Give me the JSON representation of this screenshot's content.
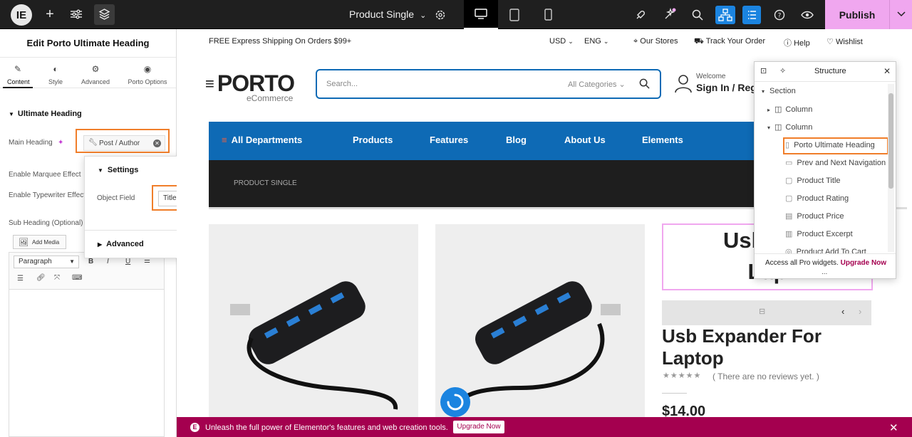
{
  "topbar": {
    "logo_glyph": "IE",
    "document_title": "Product Single",
    "publish_label": "Publish",
    "accent_color": "#f0a7ef",
    "active_icon_color": "#1b84e0"
  },
  "panel": {
    "title": "Edit Porto Ultimate Heading",
    "tabs": [
      {
        "label": "Content",
        "icon": "pencil-icon"
      },
      {
        "label": "Style",
        "icon": "contrast-icon"
      },
      {
        "label": "Advanced",
        "icon": "gear-icon"
      },
      {
        "label": "Porto Options",
        "icon": "circle-icon"
      }
    ],
    "section_title": "Ultimate Heading",
    "main_heading_label": "Main Heading",
    "dynamic_tag_value": "Post / Author",
    "marquee_label": "Enable Marquee Effect",
    "typewriter_label": "Enable Typewriter Effect",
    "sub_heading_label": "Sub Heading (Optional)",
    "add_media_label": "Add Media",
    "editor_format": "Paragraph",
    "editor_buttons": [
      "B",
      "I",
      "U"
    ]
  },
  "popup": {
    "settings_title": "Settings",
    "object_field_label": "Object Field",
    "object_field_value": "Title",
    "advanced_title": "Advanced"
  },
  "site": {
    "promo": "FREE Express Shipping On Orders $99+",
    "currency": "USD",
    "language": "ENG",
    "our_stores": "Our Stores",
    "track_order": "Track Your Order",
    "help": "Help",
    "wishlist": "Wishlist",
    "logo_main": "PORTO",
    "logo_sub": "eCommerce",
    "search_placeholder": "Search...",
    "search_category": "All Categories",
    "welcome": "Welcome",
    "sign_in": "Sign In / Reg",
    "all_departments": "All Departments",
    "nav": [
      "Products",
      "Features",
      "Blog",
      "About Us",
      "Elements"
    ],
    "breadcrumb": "PRODUCT SINGLE",
    "heading_line1": "Usb Exp",
    "heading_line2": "Lap",
    "product_title": "Usb Expander For Laptop",
    "reviews": "( There are no reviews yet. )",
    "price": "$14.00",
    "brand_color": "#0e6ab5"
  },
  "structure": {
    "title": "Structure",
    "items": [
      {
        "label": "Section",
        "icon": "",
        "level": 0,
        "arrow": "▾"
      },
      {
        "label": "Column",
        "icon": "column-icon",
        "level": 1,
        "arrow": "▸"
      },
      {
        "label": "Column",
        "icon": "column-icon",
        "level": 1,
        "arrow": "▾"
      },
      {
        "label": "Porto Ultimate Heading",
        "icon": "heading-icon",
        "level": 2
      },
      {
        "label": "Prev and Next Navigation",
        "icon": "navigation-icon",
        "level": 2
      },
      {
        "label": "Product Title",
        "icon": "title-icon",
        "level": 2
      },
      {
        "label": "Product Rating",
        "icon": "rating-icon",
        "level": 2
      },
      {
        "label": "Product Price",
        "icon": "price-icon",
        "level": 2
      },
      {
        "label": "Product Excerpt",
        "icon": "excerpt-icon",
        "level": 2
      },
      {
        "label": "Product Add To Cart",
        "icon": "cart-icon",
        "level": 2
      }
    ],
    "footer_text": "Access all Pro widgets.",
    "footer_upgrade": "Upgrade Now",
    "footer_more": "..."
  },
  "banner": {
    "icon_glyph": "E",
    "text": "Unleash the full power of Elementor's features and web creation tools.",
    "button": "Upgrade Now",
    "close": "✕",
    "color": "#a4004f"
  }
}
